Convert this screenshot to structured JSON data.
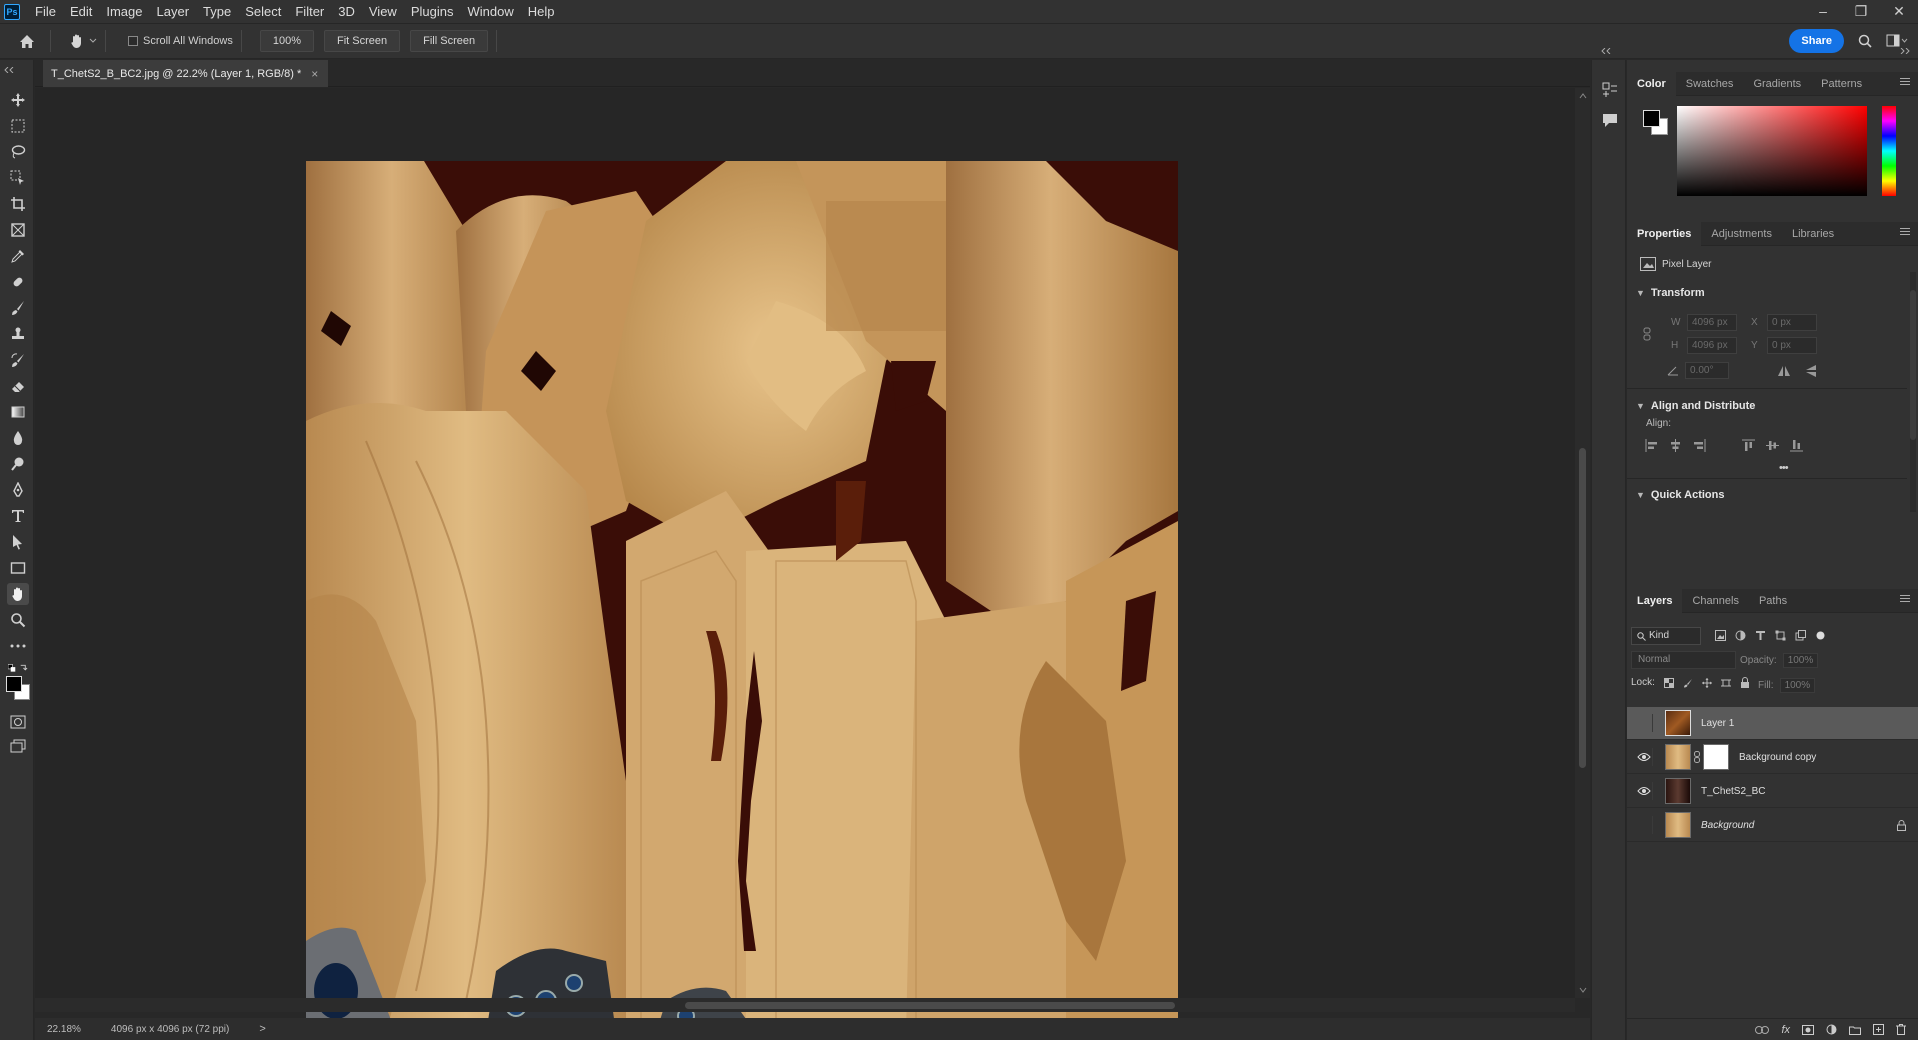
{
  "app": {
    "logo": "Ps"
  },
  "menu": [
    "File",
    "Edit",
    "Image",
    "Layer",
    "Type",
    "Select",
    "Filter",
    "3D",
    "View",
    "Plugins",
    "Window",
    "Help"
  ],
  "window_controls": {
    "minimize": "–",
    "restore": "❐",
    "close": "✕"
  },
  "options": {
    "scroll_all_label": "Scroll All Windows",
    "zoom_btn": "100%",
    "fit_screen": "Fit Screen",
    "fill_screen": "Fill Screen",
    "share": "Share"
  },
  "document": {
    "tab_title": "T_ChetS2_B_BC2.jpg @ 22.2% (Layer 1, RGB/8) *",
    "tab_close": "×"
  },
  "status": {
    "zoom": "22.18%",
    "doc_info": "4096 px x 4096 px (72 ppi)",
    "arrow": ">"
  },
  "color_panel": {
    "tabs": [
      "Color",
      "Swatches",
      "Gradients",
      "Patterns"
    ],
    "fg_color": "#000000",
    "bg_color": "#ffffff"
  },
  "properties": {
    "tabs": [
      "Properties",
      "Adjustments",
      "Libraries"
    ],
    "layer_type": "Pixel Layer",
    "transform_title": "Transform",
    "w_label": "W",
    "w_value": "4096 px",
    "h_label": "H",
    "h_value": "4096 px",
    "x_label": "X",
    "x_value": "0 px",
    "y_label": "Y",
    "y_value": "0 px",
    "angle_value": "0.00°",
    "align_title": "Align and Distribute",
    "align_label": "Align:",
    "more": "•••",
    "quick_actions_title": "Quick Actions"
  },
  "layers": {
    "tabs": [
      "Layers",
      "Channels",
      "Paths"
    ],
    "kind": "Kind",
    "blend_mode": "Normal",
    "opacity_label": "Opacity:",
    "opacity_value": "100%",
    "lock_label": "Lock:",
    "fill_label": "Fill:",
    "fill_value": "100%",
    "items": [
      {
        "name": "Layer 1",
        "visible": false,
        "selected": true
      },
      {
        "name": "Background copy",
        "visible": true,
        "selected": false
      },
      {
        "name": "T_ChetS2_BC",
        "visible": true,
        "selected": false
      },
      {
        "name": "Background",
        "visible": false,
        "selected": false,
        "locked": true
      }
    ],
    "bottom_fx": "fx"
  }
}
